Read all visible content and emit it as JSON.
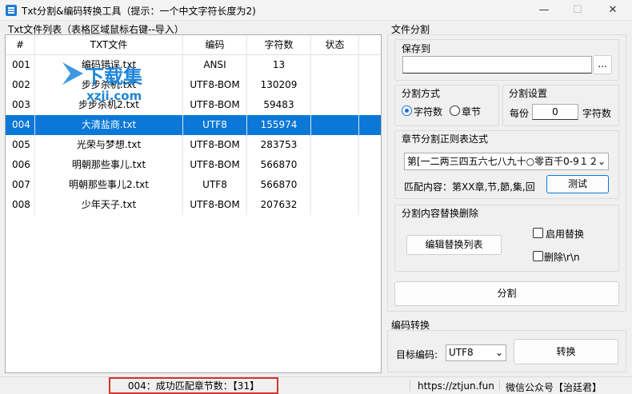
{
  "window": {
    "title": "Txt分割&编码转换工具（提示：一个中文字符长度为2)",
    "min_glyph": "—",
    "max_glyph": "☐",
    "close_glyph": "✕"
  },
  "file_list": {
    "label": "Txt文件列表（表格区域鼠标右键--导入）",
    "columns": [
      "#",
      "TXT文件",
      "编码",
      "字符数",
      "状态"
    ],
    "rows": [
      {
        "num": "001",
        "file": "编码错误.txt",
        "encoding": "ANSI",
        "chars": "13",
        "status": ""
      },
      {
        "num": "002",
        "file": "步步杀机.txt",
        "encoding": "UTF8-BOM",
        "chars": "130209",
        "status": ""
      },
      {
        "num": "003",
        "file": "步步杀机2.txt",
        "encoding": "UTF8-BOM",
        "chars": "59483",
        "status": ""
      },
      {
        "num": "004",
        "file": "大清盐商.txt",
        "encoding": "UTF8",
        "chars": "155974",
        "status": ""
      },
      {
        "num": "005",
        "file": "光荣与梦想.txt",
        "encoding": "UTF8-BOM",
        "chars": "283753",
        "status": ""
      },
      {
        "num": "006",
        "file": "明朝那些事儿.txt",
        "encoding": "UTF8-BOM",
        "chars": "566870",
        "status": ""
      },
      {
        "num": "007",
        "file": "明朝那些事儿2.txt",
        "encoding": "UTF8",
        "chars": "566870",
        "status": ""
      },
      {
        "num": "008",
        "file": "少年天子.txt",
        "encoding": "UTF8-BOM",
        "chars": "207632",
        "status": ""
      }
    ],
    "selected_index": 3
  },
  "split": {
    "label": "文件分割",
    "save_to_label": "保存到",
    "save_to_value": "",
    "browse_label": "...",
    "mode_label": "分割方式",
    "mode_chars": "字符数",
    "mode_chapter": "章节",
    "mode_selected": "字符数",
    "settings_label": "分割设置",
    "per_label": "每份",
    "per_value": "0",
    "per_unit": "字符数",
    "regex_label": "章节分割正则表达式",
    "regex_value": "第[一二两三四五六七八九十○零百千0-9１２",
    "match_text": "匹配内容：第XX章,节,節,集,回",
    "test_label": "测试",
    "replace_label": "分割内容替换删除",
    "edit_replace_label": "编辑替换列表",
    "enable_replace_label": "启用替换",
    "delete_crlf_label": "删除\\r\\n",
    "split_button": "分割"
  },
  "convert": {
    "label": "编码转换",
    "target_label": "目标编码:",
    "target_value": "UTF8",
    "convert_button": "转换"
  },
  "status": {
    "message": "004：成功匹配章节数：【31】",
    "url": "https://ztjun.fun",
    "wechat": "微信公众号【治廷君】"
  },
  "watermark": {
    "text_top": "下载集",
    "text_bottom": "xzji.com"
  },
  "colors": {
    "selected_row": "#0b78d7",
    "status_highlight_border": "#d9322b",
    "watermark": "#1f86d9"
  }
}
